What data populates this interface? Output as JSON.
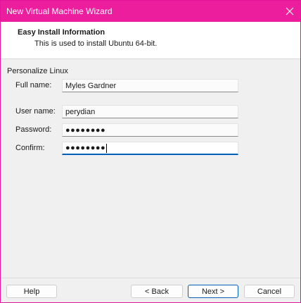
{
  "window": {
    "title": "New Virtual Machine Wizard",
    "close_icon": "close-icon"
  },
  "header": {
    "title": "Easy Install Information",
    "subtitle": "This is used to install Ubuntu 64-bit."
  },
  "form": {
    "group_label": "Personalize Linux",
    "full_name_label": "Full name:",
    "full_name_value": "Myles Gardner",
    "user_name_label": "User name:",
    "user_name_value": "perydian",
    "password_label": "Password:",
    "password_masked": "●●●●●●●●",
    "confirm_label": "Confirm:",
    "confirm_masked": "●●●●●●●●"
  },
  "buttons": {
    "help": "Help",
    "back": "< Back",
    "next": "Next >",
    "cancel": "Cancel"
  },
  "colors": {
    "titlebar": "#ec1e9e",
    "focus_accent": "#005fb8"
  }
}
